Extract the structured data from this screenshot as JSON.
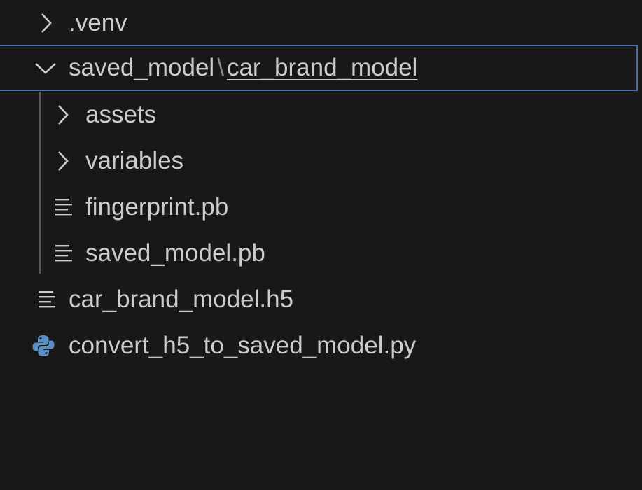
{
  "explorer": {
    "items": [
      {
        "label": ".venv",
        "icon": "chevron-right-icon"
      },
      {
        "label_part1": "saved_model",
        "separator": "\\",
        "label_part2": "car_brand_model",
        "icon": "chevron-down-icon"
      },
      {
        "label": "assets",
        "icon": "chevron-right-icon"
      },
      {
        "label": "variables",
        "icon": "chevron-right-icon"
      },
      {
        "label": "fingerprint.pb",
        "icon": "file-lines-icon"
      },
      {
        "label": "saved_model.pb",
        "icon": "file-lines-icon"
      },
      {
        "label": "car_brand_model.h5",
        "icon": "file-lines-icon"
      },
      {
        "label": "convert_h5_to_saved_model.py",
        "icon": "python-icon"
      }
    ]
  },
  "colors": {
    "background": "#181818",
    "text": "#cccccc",
    "selection_border": "#4a6ea9",
    "python_blue": "#5a8fc4"
  }
}
